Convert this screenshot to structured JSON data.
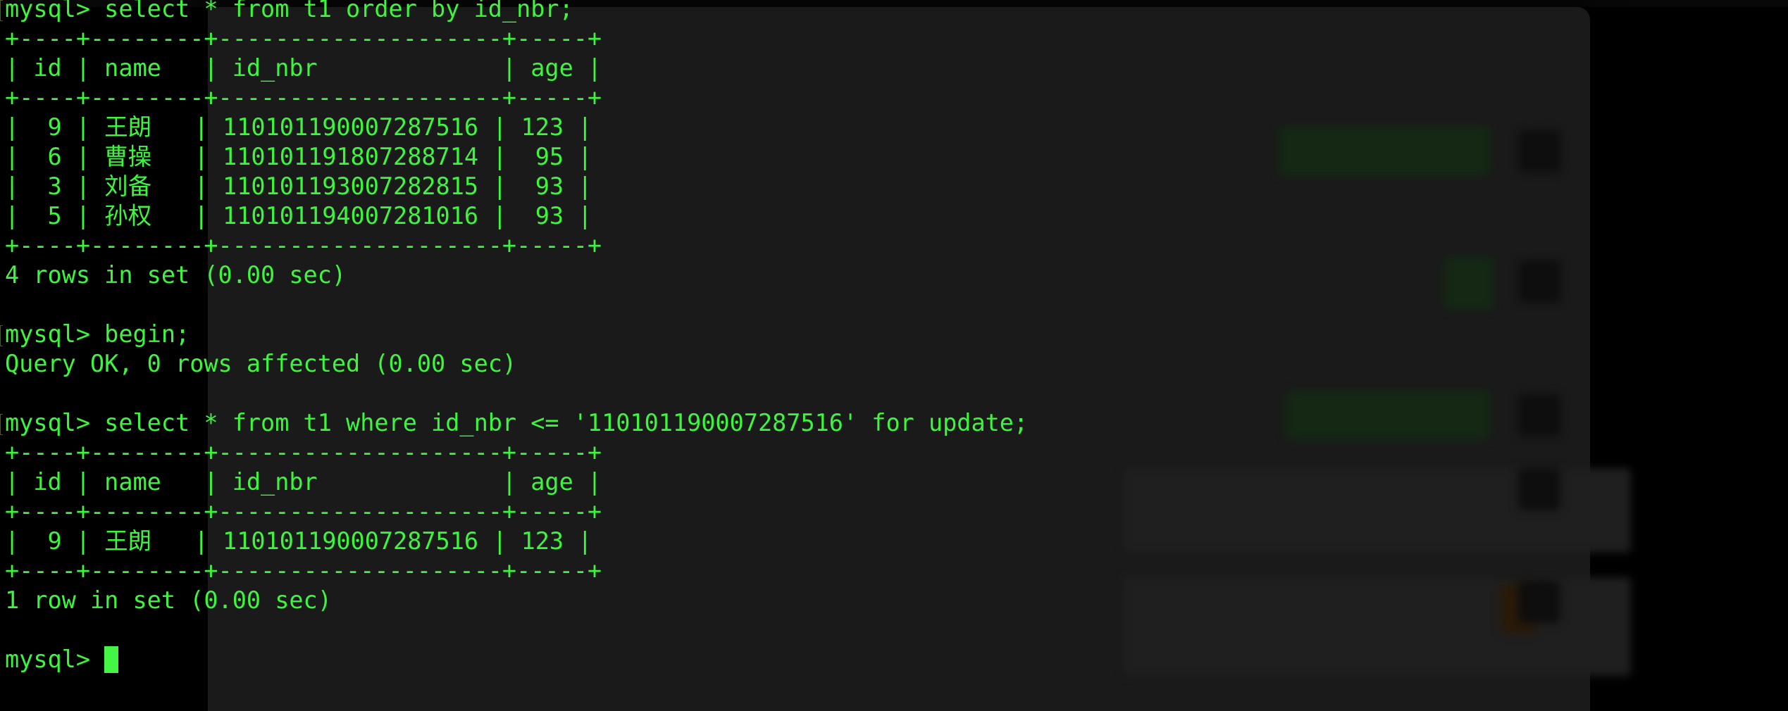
{
  "terminal": {
    "prompt": "mysql> ",
    "accent_color": "#3df53d",
    "lines": [
      {
        "text": "mysql> select * from t1 order by id_nbr;",
        "kind": "command"
      },
      {
        "text": "+----+--------+--------------------+-----+",
        "kind": "output"
      },
      {
        "text": "| id | name   | id_nbr             | age |",
        "kind": "output"
      },
      {
        "text": "+----+--------+--------------------+-----+",
        "kind": "output"
      },
      {
        "text": "|  9 | 王朗   | 110101190007287516 | 123 |",
        "kind": "output"
      },
      {
        "text": "|  6 | 曹操   | 110101191807288714 |  95 |",
        "kind": "output"
      },
      {
        "text": "|  3 | 刘备   | 110101193007282815 |  93 |",
        "kind": "output"
      },
      {
        "text": "|  5 | 孙权   | 110101194007281016 |  93 |",
        "kind": "output"
      },
      {
        "text": "+----+--------+--------------------+-----+",
        "kind": "output"
      },
      {
        "text": "4 rows in set (0.00 sec)",
        "kind": "output"
      },
      {
        "text": "",
        "kind": "blank"
      },
      {
        "text": "mysql> begin;",
        "kind": "command"
      },
      {
        "text": "Query OK, 0 rows affected (0.00 sec)",
        "kind": "output"
      },
      {
        "text": "",
        "kind": "blank"
      },
      {
        "text": "mysql> select * from t1 where id_nbr <= '110101190007287516' for update;",
        "kind": "command"
      },
      {
        "text": "+----+--------+--------------------+-----+",
        "kind": "output"
      },
      {
        "text": "| id | name   | id_nbr             | age |",
        "kind": "output"
      },
      {
        "text": "+----+--------+--------------------+-----+",
        "kind": "output"
      },
      {
        "text": "|  9 | 王朗   | 110101190007287516 | 123 |",
        "kind": "output"
      },
      {
        "text": "+----+--------+--------------------+-----+",
        "kind": "output"
      },
      {
        "text": "1 row in set (0.00 sec)",
        "kind": "output"
      },
      {
        "text": "",
        "kind": "blank"
      }
    ],
    "current_input": ""
  },
  "query_results": [
    {
      "query": "select * from t1 order by id_nbr;",
      "columns": [
        "id",
        "name",
        "id_nbr",
        "age"
      ],
      "rows": [
        [
          "9",
          "王朗",
          "110101190007287516",
          "123"
        ],
        [
          "6",
          "曹操",
          "110101191807288714",
          "95"
        ],
        [
          "3",
          "刘备",
          "110101193007282815",
          "93"
        ],
        [
          "5",
          "孙权",
          "110101194007281016",
          "93"
        ]
      ],
      "summary": "4 rows in set (0.00 sec)"
    },
    {
      "query": "begin;",
      "summary": "Query OK, 0 rows affected (0.00 sec)"
    },
    {
      "query": "select * from t1 where id_nbr <= '110101190007287516' for update;",
      "columns": [
        "id",
        "name",
        "id_nbr",
        "age"
      ],
      "rows": [
        [
          "9",
          "王朗",
          "110101190007287516",
          "123"
        ]
      ],
      "summary": "1 row in set (0.00 sec)"
    }
  ]
}
